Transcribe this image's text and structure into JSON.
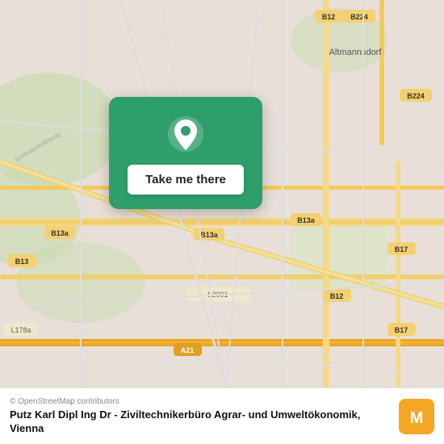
{
  "map": {
    "alt": "OpenStreetMap of Vienna area",
    "copyright": "© OpenStreetMap contributors"
  },
  "popup": {
    "button_label": "Take me there"
  },
  "info_bar": {
    "copyright": "© OpenStreetMap contributors",
    "location_name": "Putz Karl Dipl Ing Dr - Ziviltechnikerbüro Agrar- und Umweltökonomik, Vienna"
  },
  "icons": {
    "pin": "location-pin",
    "moovit": "moovit-logo"
  },
  "colors": {
    "green": "#2e9e6b",
    "map_bg": "#e8e0d8"
  }
}
